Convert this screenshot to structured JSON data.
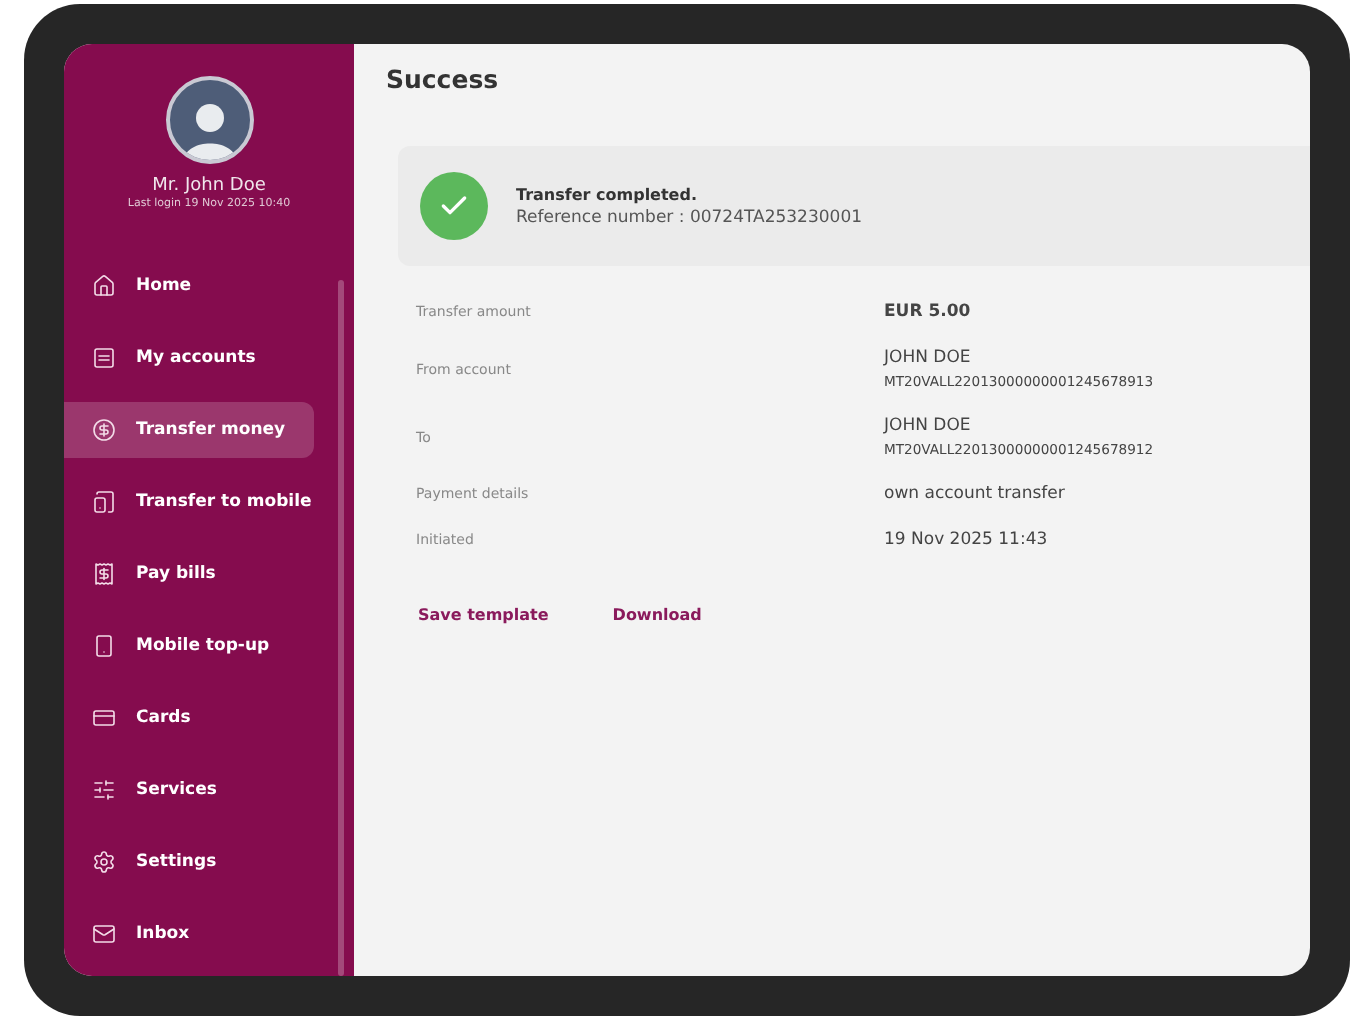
{
  "profile": {
    "name": "Mr. John Doe",
    "last_login": "Last login  19 Nov 2025 10:40"
  },
  "nav": [
    {
      "label": "Home",
      "selected": false
    },
    {
      "label": "My accounts",
      "selected": false
    },
    {
      "label": "Transfer money",
      "selected": true
    },
    {
      "label": "Transfer to mobile",
      "selected": false
    },
    {
      "label": "Pay bills",
      "selected": false
    },
    {
      "label": "Mobile top-up",
      "selected": false
    },
    {
      "label": "Cards",
      "selected": false
    },
    {
      "label": "Services",
      "selected": false
    },
    {
      "label": "Settings",
      "selected": false
    },
    {
      "label": "Inbox",
      "selected": false
    }
  ],
  "page_title": "Success",
  "banner": {
    "title": "Transfer completed.",
    "reference": "Reference number : 00724TA253230001"
  },
  "details": [
    {
      "label": "Transfer amount",
      "lines": [
        "EUR 5.00"
      ]
    },
    {
      "label": "From account",
      "lines": [
        "JOHN DOE",
        "MT20VALL22013000000001245678913"
      ]
    },
    {
      "label": "To",
      "lines": [
        "JOHN DOE",
        "MT20VALL22013000000001245678912"
      ]
    },
    {
      "label": "Payment details",
      "lines": [
        "own account transfer"
      ]
    },
    {
      "label": "Initiated",
      "lines": [
        "19 Nov 2025 11:43"
      ]
    }
  ],
  "actions": [
    "Save template",
    "Download"
  ]
}
